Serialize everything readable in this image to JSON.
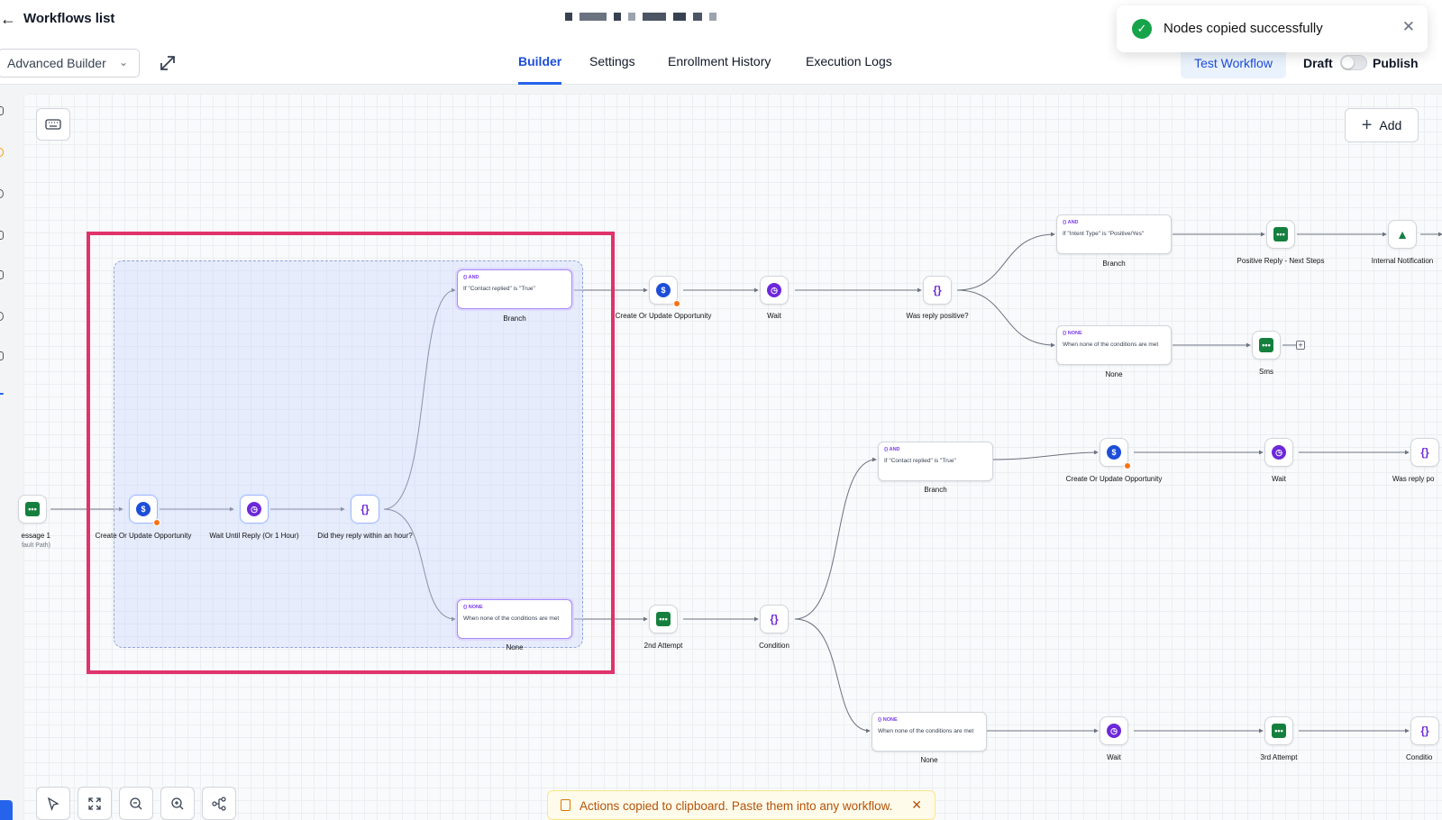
{
  "header": {
    "back_icon": "arrow-left-icon",
    "back_label": "Workflows list"
  },
  "toast": {
    "message": "Nodes copied successfully",
    "icon": "check-circle-icon"
  },
  "subheader": {
    "builder_select": "Advanced Builder",
    "tabs": [
      "Builder",
      "Settings",
      "Enrollment History",
      "Execution Logs"
    ],
    "active_tab": "Builder",
    "test_workflow": "Test Workflow",
    "draft": "Draft",
    "publish": "Publish",
    "publish_toggle_on": false
  },
  "canvas": {
    "add_label": "Add",
    "nodes": {
      "msg1": "essage 1",
      "msg1_sub": "fault Path)",
      "g_create": "Create Or Update Opportunity",
      "g_wait": "Wait Until Reply (Or 1 Hour)",
      "g_cond": "Did they reply within an hour?",
      "g_branch_tag": "{} AND",
      "g_branch_cond": "If \"Contact replied\" is \"True\"",
      "g_branch_label": "Branch",
      "g_none_tag": "{} NONE",
      "g_none_cond": "When none of the conditions are met",
      "g_none_label": "None",
      "t_create": "Create Or Update Opportunity",
      "t_wait": "Wait",
      "t_cond": "Was reply positive?",
      "tb_tag": "{} AND",
      "tb_cond": "If \"Intent Type\" is \"Positive/Yes\"",
      "tb_label": "Branch",
      "tb_reply": "Positive Reply - Next Steps",
      "tb_notif": "Internal Notification",
      "tn_tag": "{} NONE",
      "tn_cond": "When none of the conditions are met",
      "tn_label": "None",
      "tn_sms": "Sms",
      "b_attempt2": "2nd Attempt",
      "b_cond": "Condition",
      "mb_tag": "{} AND",
      "mb_cond": "If \"Contact replied\" is \"True\"",
      "mb_label": "Branch",
      "mb_create": "Create Or Update Opportunity",
      "mb_wait": "Wait",
      "mb_was": "Was reply po",
      "bn_tag": "{} NONE",
      "bn_cond": "When none of the conditions are met",
      "bn_label": "None",
      "bn_wait": "Wait",
      "bn_attempt3": "3rd Attempt",
      "bn_cond2": "Conditio"
    }
  },
  "bottom_toast": {
    "message": "Actions copied to clipboard. Paste them into any workflow."
  },
  "colors": {
    "accent": "#2563eb",
    "selection": "#e0336b",
    "success": "#16a34a",
    "warning": "#b45309"
  }
}
